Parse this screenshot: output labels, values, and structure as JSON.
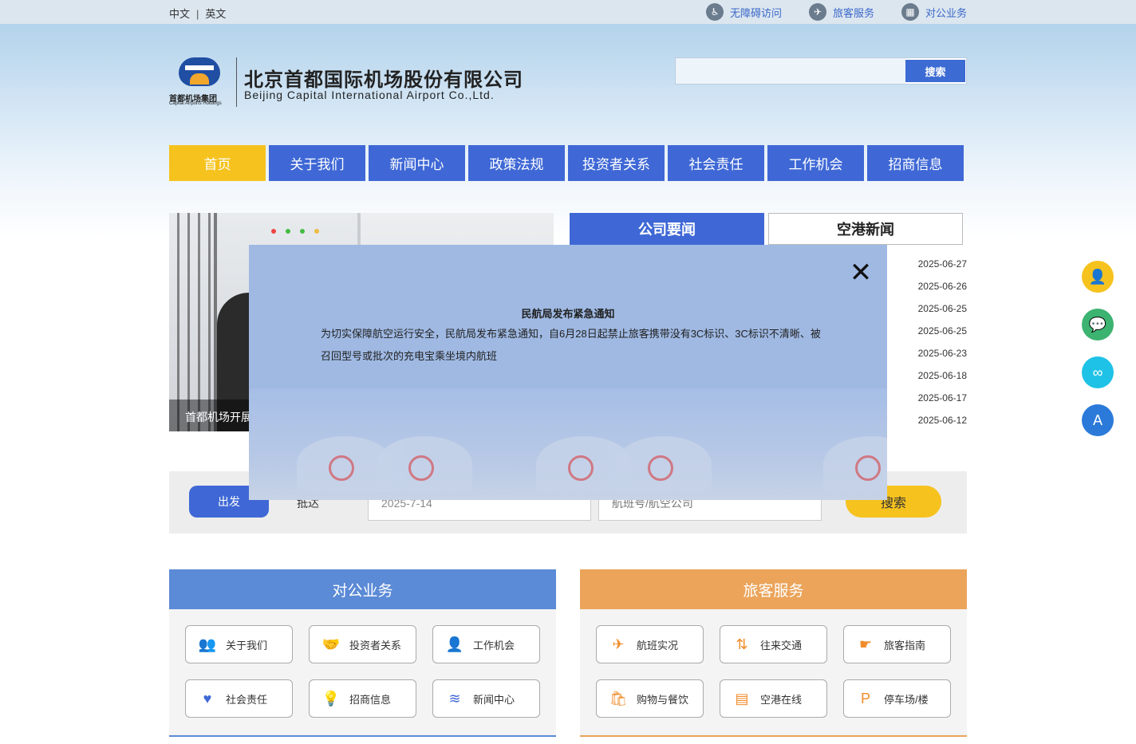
{
  "topbar": {
    "lang_cn": "中文",
    "lang_sep": "|",
    "lang_en": "英文",
    "links": [
      {
        "icon": "accessibility-icon",
        "glyph": "♿",
        "label": "无障碍访问"
      },
      {
        "icon": "airplane-icon",
        "glyph": "✈",
        "label": "旅客服务"
      },
      {
        "icon": "grid-icon",
        "glyph": "▦",
        "label": "对公业务"
      }
    ]
  },
  "logo": {
    "mark_cn": "首都机场集团",
    "mark_en": "Capital Airports Holdings",
    "company_cn": "北京首都国际机场股份有限公司",
    "company_en": "Beijing Capital International Airport Co.,Ltd."
  },
  "search": {
    "value": "",
    "button": "搜索"
  },
  "nav": [
    "首页",
    "关于我们",
    "新闻中心",
    "政策法规",
    "投资者关系",
    "社会责任",
    "工作机会",
    "招商信息"
  ],
  "slider": {
    "caption": "首都机场开展"
  },
  "news": {
    "tab_active": "公司要闻",
    "tab_other": "空港新闻",
    "dates": [
      "2025-06-27",
      "2025-06-26",
      "2025-06-25",
      "2025-06-25",
      "2025-06-23",
      "2025-06-18",
      "2025-06-17",
      "2025-06-12"
    ]
  },
  "flight_search": {
    "depart": "出发",
    "arrive": "抵达",
    "date_value": "2025-7-14",
    "flight_placeholder": "航班号/航空公司",
    "button": "搜索"
  },
  "business": {
    "title": "对公业务",
    "items": [
      {
        "glyph": "👥",
        "icon": "people-icon",
        "label": "关于我们"
      },
      {
        "glyph": "🤝",
        "icon": "handshake-icon",
        "label": "投资者关系"
      },
      {
        "glyph": "👤",
        "icon": "worker-icon",
        "label": "工作机会"
      },
      {
        "glyph": "♥",
        "icon": "heart-hand-icon",
        "label": "社会责任"
      },
      {
        "glyph": "💡",
        "icon": "lightbulb-icon",
        "label": "招商信息"
      },
      {
        "glyph": "≋",
        "icon": "layers-icon",
        "label": "新闻中心"
      }
    ]
  },
  "passenger": {
    "title": "旅客服务",
    "items": [
      {
        "glyph": "✈",
        "icon": "flight-icon",
        "label": "航班实况"
      },
      {
        "glyph": "⇅",
        "icon": "transport-icon",
        "label": "往来交通"
      },
      {
        "glyph": "☛",
        "icon": "guide-hand-icon",
        "label": "旅客指南"
      },
      {
        "glyph": "🛍",
        "icon": "shopping-bag-icon",
        "label": "购物与餐饮"
      },
      {
        "glyph": "▤",
        "icon": "document-icon",
        "label": "空港在线"
      },
      {
        "glyph": "P",
        "icon": "parking-icon",
        "label": "停车场/楼"
      }
    ]
  },
  "floats": [
    {
      "icon": "user-desk-icon",
      "glyph": "👤",
      "color": "#f6c21e"
    },
    {
      "icon": "wechat-icon",
      "glyph": "💬",
      "color": "#3cb371"
    },
    {
      "icon": "mini-program-icon",
      "glyph": "∞",
      "color": "#1ec2e6"
    },
    {
      "icon": "app-store-icon",
      "glyph": "A",
      "color": "#2b7ad9"
    }
  ],
  "modal": {
    "close": "✕",
    "title": "民航局发布紧急通知",
    "body": "为切实保障航空运行安全，民航局发布紧急通知，自6月28日起禁止旅客携带没有3C标识、3C标识不清晰、被召回型号或批次的充电宝乘坐境内航班"
  },
  "colors": {
    "primary_blue": "#3f68d6",
    "accent_yellow": "#f6c21e",
    "business_blue": "#5b8ad6",
    "passenger_orange": "#eba45a",
    "modal_bg": "#9fb9e3"
  }
}
